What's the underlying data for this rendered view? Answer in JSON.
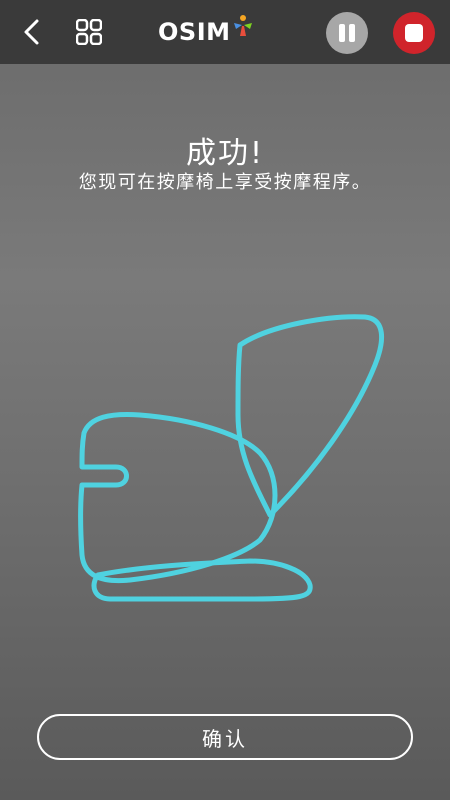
{
  "header": {
    "back_icon": "chevron-left-icon",
    "menu_icon": "grid-icon",
    "logo_text": "OSIM",
    "logo_mark": "osim-figure-logo",
    "pause_icon": "pause-icon",
    "stop_icon": "stop-icon",
    "colors": {
      "bar": "#3a3a3a",
      "pause": "#a7a7a7",
      "stop": "#d0242b"
    }
  },
  "main": {
    "title": "成功!",
    "subtitle": "您现可在按摩椅上享受按摩程序。",
    "illustration": "massage-chair-outline",
    "illustration_color": "#4fd2e0"
  },
  "footer": {
    "confirm_label": "确认"
  }
}
